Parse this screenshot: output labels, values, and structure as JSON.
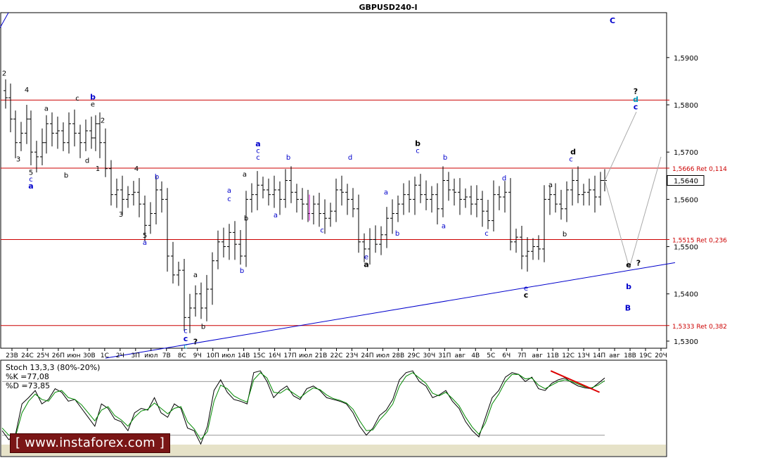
{
  "chart_data": [
    {
      "type": "candlestick",
      "title": "GBPUSD240-I",
      "price_axis": {
        "ylim": [
          1.5285,
          1.5995
        ],
        "ticks": [
          "1,5300",
          "1,5400",
          "1,5500",
          "1,5600",
          "1,5700",
          "1,5800",
          "1,5900"
        ],
        "current_price": "1,5640"
      },
      "time_axis": {
        "ticks": [
          "23В",
          "24С",
          "25Ч",
          "26П",
          "июн",
          "30В",
          "1С",
          "2Ч",
          "3П",
          "июл",
          "7В",
          "8С",
          "9Ч",
          "10П",
          "июл",
          "14В",
          "15С",
          "16Ч",
          "17П",
          "июл",
          "21В",
          "22С",
          "23Ч",
          "24П",
          "июл",
          "28В",
          "29С",
          "30Ч",
          "31П",
          "авг",
          "4В",
          "5С",
          "6Ч",
          "7П",
          "авг",
          "11В",
          "12С",
          "13Ч",
          "14П",
          "авг",
          "18В",
          "19С",
          "20Ч"
        ]
      },
      "levels": [
        {
          "value": 1.581,
          "label": ""
        },
        {
          "value": 1.5666,
          "label": "1,5666 Ret 0,114"
        },
        {
          "value": 1.5515,
          "label": "1,5515 Ret 0,236"
        },
        {
          "value": 1.5333,
          "label": "1,5333 Ret 0,382"
        }
      ],
      "trendlines": [
        {
          "from": [
            0,
            1.5963
          ],
          "to": [
            12,
            1.5995
          ]
        },
        {
          "from": [
            150,
            1.5264
          ],
          "to": [
            960,
            1.5466
          ]
        }
      ],
      "projection": {
        "color": "#aaaaaa",
        "points": [
          [
            860,
            1.564
          ],
          [
            905,
            1.5785
          ],
          [
            905,
            1.5785
          ]
        ],
        "path2": [
          [
            860,
            1.564
          ],
          [
            895,
            1.5455
          ],
          [
            940,
            1.569
          ]
        ]
      },
      "close_path": [
        [
          0,
          1.583
        ],
        [
          8,
          1.5815
        ],
        [
          15,
          1.577
        ],
        [
          22,
          1.572
        ],
        [
          30,
          1.574
        ],
        [
          38,
          1.577
        ],
        [
          44,
          1.57
        ],
        [
          52,
          1.569
        ],
        [
          60,
          1.572
        ],
        [
          66,
          1.576
        ],
        [
          74,
          1.574
        ],
        [
          82,
          1.5745
        ],
        [
          90,
          1.572
        ],
        [
          98,
          1.576
        ],
        [
          106,
          1.574
        ],
        [
          114,
          1.572
        ],
        [
          122,
          1.5745
        ],
        [
          130,
          1.573
        ],
        [
          136,
          1.576
        ],
        [
          142,
          1.572
        ],
        [
          150,
          1.5665
        ],
        [
          158,
          1.561
        ],
        [
          166,
          1.562
        ],
        [
          174,
          1.56
        ],
        [
          182,
          1.561
        ],
        [
          190,
          1.5615
        ],
        [
          198,
          1.559
        ],
        [
          206,
          1.5545
        ],
        [
          214,
          1.557
        ],
        [
          222,
          1.562
        ],
        [
          230,
          1.56
        ],
        [
          238,
          1.548
        ],
        [
          246,
          1.544
        ],
        [
          254,
          1.545
        ],
        [
          262,
          1.535
        ],
        [
          270,
          1.537
        ],
        [
          278,
          1.54
        ],
        [
          286,
          1.537
        ],
        [
          294,
          1.541
        ],
        [
          302,
          1.547
        ],
        [
          310,
          1.551
        ],
        [
          318,
          1.55
        ],
        [
          326,
          1.553
        ],
        [
          334,
          1.5505
        ],
        [
          342,
          1.548
        ],
        [
          350,
          1.56
        ],
        [
          358,
          1.561
        ],
        [
          366,
          1.563
        ],
        [
          374,
          1.562
        ],
        [
          382,
          1.561
        ],
        [
          390,
          1.562
        ],
        [
          398,
          1.56
        ],
        [
          406,
          1.564
        ],
        [
          414,
          1.5615
        ],
        [
          422,
          1.56
        ],
        [
          430,
          1.559
        ],
        [
          438,
          1.557
        ],
        [
          446,
          1.559
        ],
        [
          454,
          1.557
        ],
        [
          462,
          1.556
        ],
        [
          470,
          1.5575
        ],
        [
          478,
          1.562
        ],
        [
          486,
          1.5615
        ],
        [
          494,
          1.56
        ],
        [
          502,
          1.558
        ],
        [
          510,
          1.551
        ],
        [
          518,
          1.5495
        ],
        [
          526,
          1.5515
        ],
        [
          534,
          1.5505
        ],
        [
          542,
          1.5525
        ],
        [
          550,
          1.556
        ],
        [
          558,
          1.557
        ],
        [
          566,
          1.559
        ],
        [
          574,
          1.561
        ],
        [
          582,
          1.56
        ],
        [
          590,
          1.563
        ],
        [
          598,
          1.561
        ],
        [
          606,
          1.56
        ],
        [
          614,
          1.561
        ],
        [
          622,
          1.558
        ],
        [
          630,
          1.564
        ],
        [
          638,
          1.562
        ],
        [
          646,
          1.5615
        ],
        [
          654,
          1.56
        ],
        [
          662,
          1.5605
        ],
        [
          670,
          1.559
        ],
        [
          678,
          1.56
        ],
        [
          686,
          1.5575
        ],
        [
          694,
          1.5555
        ],
        [
          702,
          1.561
        ],
        [
          710,
          1.5605
        ],
        [
          718,
          1.5615
        ],
        [
          726,
          1.551
        ],
        [
          734,
          1.552
        ],
        [
          742,
          1.548
        ],
        [
          750,
          1.549
        ],
        [
          758,
          1.55
        ],
        [
          766,
          1.5495
        ],
        [
          774,
          1.56
        ],
        [
          782,
          1.561
        ],
        [
          790,
          1.559
        ],
        [
          798,
          1.558
        ],
        [
          806,
          1.562
        ],
        [
          814,
          1.564
        ],
        [
          822,
          1.561
        ],
        [
          830,
          1.5615
        ],
        [
          838,
          1.562
        ],
        [
          846,
          1.5605
        ],
        [
          854,
          1.564
        ],
        [
          860,
          1.564
        ]
      ],
      "wave_labels": [
        {
          "text": "2",
          "x": 6,
          "price": 1.5862,
          "color": "#000000"
        },
        {
          "text": "3",
          "x": 26,
          "price": 1.568,
          "color": "#000000"
        },
        {
          "text": "4",
          "x": 38,
          "price": 1.5827,
          "color": "#000000"
        },
        {
          "text": "5",
          "x": 44,
          "price": 1.5652,
          "color": "#000000"
        },
        {
          "text": "c",
          "x": 44,
          "price": 1.5638,
          "color": "#0000cc"
        },
        {
          "text": "a",
          "x": 44,
          "price": 1.5623,
          "color": "#0000cc",
          "bold": true
        },
        {
          "text": "a",
          "x": 66,
          "price": 1.5787,
          "color": "#000000"
        },
        {
          "text": "b",
          "x": 94,
          "price": 1.5646,
          "color": "#000000"
        },
        {
          "text": "c",
          "x": 110,
          "price": 1.5809,
          "color": "#000000"
        },
        {
          "text": "d",
          "x": 124,
          "price": 1.5677,
          "color": "#000000"
        },
        {
          "text": "b",
          "x": 132,
          "price": 1.5811,
          "color": "#0000cc",
          "bold": true
        },
        {
          "text": "e",
          "x": 132,
          "price": 1.5796,
          "color": "#000000"
        },
        {
          "text": "2",
          "x": 146,
          "price": 1.5762,
          "color": "#000000"
        },
        {
          "text": "1",
          "x": 139,
          "price": 1.566,
          "color": "#000000"
        },
        {
          "text": "4",
          "x": 194,
          "price": 1.566,
          "color": "#000000"
        },
        {
          "text": "3",
          "x": 172,
          "price": 1.5563,
          "color": "#000000"
        },
        {
          "text": "b",
          "x": 223,
          "price": 1.5643,
          "color": "#0000cc"
        },
        {
          "text": "5",
          "x": 206,
          "price": 1.5519,
          "color": "#000000"
        },
        {
          "text": "a",
          "x": 206,
          "price": 1.5504,
          "color": "#0000cc"
        },
        {
          "text": "a",
          "x": 278,
          "price": 1.5435,
          "color": "#000000"
        },
        {
          "text": "c",
          "x": 264,
          "price": 1.5317,
          "color": "#0000cc"
        },
        {
          "text": "c",
          "x": 264,
          "price": 1.53,
          "color": "#0000cc",
          "bold": true
        },
        {
          "text": "c",
          "x": 264,
          "price": 1.5284,
          "color": "#0099bb"
        },
        {
          "text": "b",
          "x": 289,
          "price": 1.5326,
          "color": "#000000"
        },
        {
          "text": "?",
          "x": 278,
          "price": 1.5293,
          "color": "#000000",
          "bold": true
        },
        {
          "text": "b",
          "x": 344,
          "price": 1.5444,
          "color": "#0000cc"
        },
        {
          "text": "b",
          "x": 350,
          "price": 1.5555,
          "color": "#000000"
        },
        {
          "text": "a",
          "x": 326,
          "price": 1.5614,
          "color": "#0000cc"
        },
        {
          "text": "c",
          "x": 326,
          "price": 1.5596,
          "color": "#0000cc"
        },
        {
          "text": "a",
          "x": 348,
          "price": 1.5648,
          "color": "#000000"
        },
        {
          "text": "a",
          "x": 367,
          "price": 1.5712,
          "color": "#0000cc",
          "bold": true
        },
        {
          "text": "c",
          "x": 367,
          "price": 1.5698,
          "color": "#0000cc"
        },
        {
          "text": "c",
          "x": 367,
          "price": 1.5684,
          "color": "#0000cc"
        },
        {
          "text": "a",
          "x": 392,
          "price": 1.5562,
          "color": "#0000cc"
        },
        {
          "text": "b",
          "x": 410,
          "price": 1.5684,
          "color": "#0000cc"
        },
        {
          "text": "c",
          "x": 458,
          "price": 1.553,
          "color": "#0000cc"
        },
        {
          "text": "d",
          "x": 498,
          "price": 1.5684,
          "color": "#0000cc"
        },
        {
          "text": "e",
          "x": 521,
          "price": 1.5473,
          "color": "#0000cc"
        },
        {
          "text": "a",
          "x": 521,
          "price": 1.5457,
          "color": "#000000",
          "bold": true
        },
        {
          "text": "a",
          "x": 549,
          "price": 1.561,
          "color": "#0000cc"
        },
        {
          "text": "b",
          "x": 565,
          "price": 1.5523,
          "color": "#0000cc"
        },
        {
          "text": "b",
          "x": 594,
          "price": 1.5713,
          "color": "#000000",
          "bold": true
        },
        {
          "text": "c",
          "x": 594,
          "price": 1.5698,
          "color": "#0000cc"
        },
        {
          "text": "b",
          "x": 633,
          "price": 1.5684,
          "color": "#0000cc"
        },
        {
          "text": "a",
          "x": 631,
          "price": 1.5539,
          "color": "#0000cc"
        },
        {
          "text": "c",
          "x": 692,
          "price": 1.5523,
          "color": "#0000cc"
        },
        {
          "text": "d",
          "x": 717,
          "price": 1.564,
          "color": "#0000cc"
        },
        {
          "text": "e",
          "x": 748,
          "price": 1.5407,
          "color": "#0000cc"
        },
        {
          "text": "c",
          "x": 748,
          "price": 1.5392,
          "color": "#000000",
          "bold": true
        },
        {
          "text": "a",
          "x": 783,
          "price": 1.5626,
          "color": "#000000"
        },
        {
          "text": "b",
          "x": 803,
          "price": 1.5522,
          "color": "#000000"
        },
        {
          "text": "d",
          "x": 815,
          "price": 1.5695,
          "color": "#000000",
          "bold": true
        },
        {
          "text": "c",
          "x": 812,
          "price": 1.568,
          "color": "#0000cc"
        },
        {
          "text": "?",
          "x": 904,
          "price": 1.5823,
          "color": "#000000",
          "bold": true
        },
        {
          "text": "d",
          "x": 904,
          "price": 1.5806,
          "color": "#0099bb",
          "bold": true
        },
        {
          "text": "c",
          "x": 904,
          "price": 1.579,
          "color": "#0000cc",
          "bold": true
        },
        {
          "text": "e",
          "x": 894,
          "price": 1.5456,
          "color": "#000000",
          "bold": true
        },
        {
          "text": "?",
          "x": 908,
          "price": 1.546,
          "color": "#000000",
          "bold": true
        },
        {
          "text": "b",
          "x": 894,
          "price": 1.541,
          "color": "#0000cc",
          "bold": true
        },
        {
          "text": "B",
          "x": 893,
          "price": 1.5365,
          "color": "#0000cc",
          "bold": true
        },
        {
          "text": "C",
          "x": 871,
          "price": 1.5973,
          "color": "#0000cc",
          "bold": true
        }
      ]
    },
    {
      "type": "line",
      "title": "Stoch 13,3,3 (80%-20%)",
      "k_label": "%K =77,08",
      "d_label": "%D =73,85",
      "ylim": [
        0,
        100
      ],
      "levels": [
        80,
        20
      ],
      "series": [
        {
          "name": "%K",
          "color": "#000000",
          "values": [
            25,
            15,
            20,
            55,
            62,
            70,
            55,
            60,
            72,
            68,
            58,
            60,
            50,
            40,
            30,
            55,
            50,
            38,
            35,
            25,
            45,
            50,
            48,
            62,
            45,
            40,
            55,
            50,
            28,
            25,
            10,
            30,
            70,
            82,
            68,
            60,
            58,
            55,
            90,
            92,
            80,
            62,
            70,
            75,
            64,
            60,
            72,
            75,
            70,
            62,
            60,
            58,
            55,
            45,
            30,
            20,
            28,
            42,
            48,
            60,
            82,
            90,
            92,
            80,
            75,
            62,
            65,
            70,
            58,
            50,
            35,
            25,
            18,
            40,
            62,
            70,
            85,
            90,
            88,
            80,
            85,
            72,
            70,
            78,
            82,
            84,
            79,
            75,
            73,
            72,
            78,
            84
          ]
        },
        {
          "name": "%D",
          "color": "#008800",
          "values": [
            28,
            20,
            18,
            45,
            58,
            66,
            60,
            58,
            68,
            70,
            62,
            60,
            54,
            45,
            36,
            48,
            52,
            42,
            37,
            30,
            40,
            47,
            49,
            56,
            50,
            44,
            50,
            52,
            35,
            27,
            15,
            24,
            58,
            76,
            72,
            64,
            60,
            57,
            82,
            90,
            84,
            68,
            67,
            72,
            67,
            62,
            68,
            73,
            71,
            65,
            61,
            59,
            56,
            49,
            36,
            25,
            26,
            37,
            45,
            55,
            75,
            86,
            90,
            84,
            78,
            67,
            64,
            68,
            61,
            53,
            40,
            29,
            21,
            34,
            55,
            66,
            80,
            88,
            88,
            83,
            84,
            76,
            72,
            76,
            80,
            82,
            80,
            77,
            74,
            73,
            76,
            81
          ]
        }
      ],
      "divergence_line": {
        "color": "#dd0000",
        "from_index": 82,
        "to_index": 90
      }
    }
  ],
  "watermark": {
    "text": "[ www.instaforex.com ]"
  }
}
